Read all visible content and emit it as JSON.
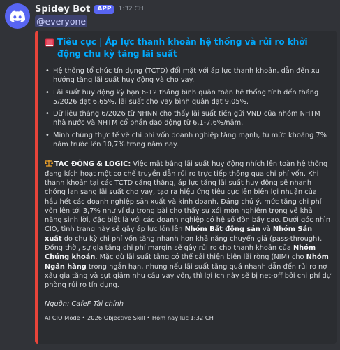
{
  "bot": {
    "name": "Spidey Bot",
    "badge": "APP",
    "time": "1:32 CH",
    "mention": "@everyone"
  },
  "embed": {
    "accent_color": "#e8443a",
    "title_icon": "red-book-icon",
    "title": "Tiêu cực | Áp lực thanh khoản hệ thống và rủi ro khởi động chu kỳ tăng lãi suất",
    "bullets": [
      "Hệ thống tổ chức tín dụng (TCTD) đối mặt với áp lực thanh khoản, dẫn đến xu hướng tăng lãi suất huy động và cho vay.",
      "Lãi suất huy động kỳ hạn 6-12 tháng bình quân toàn hệ thống tính đến tháng 5/2026 đạt 6,65%, lãi suất cho vay bình quân đạt 9,05%.",
      "Dữ liệu tháng 6/2026 từ NHNN cho thấy lãi suất tiền gửi VND của nhóm NHTM nhà nước và NHTM cổ phần dao động từ 6,1-7,6%/năm.",
      "Minh chứng thực tế về chi phí vốn doanh nghiệp tăng mạnh, từ mức khoảng 7% năm trước lên 10,7% trong năm nay."
    ],
    "analysis": {
      "icon": "scales-icon",
      "label": "TÁC ĐỘNG & LOGIC:",
      "t1": " Việc mặt bằng lãi suất huy động nhích lên toàn hệ thống đang kích hoạt một cơ chế truyền dẫn rủi ro trực tiếp thông qua chi phí vốn. Khi thanh khoản tại các TCTD căng thẳng, áp lực tăng lãi suất huy động sẽ nhanh chóng lan sang lãi suất cho vay, tạo ra hiệu ứng tiêu cực lên biên lợi nhuận của hầu hết các doanh nghiệp sản xuất và kinh doanh. Đáng chú ý, mức tăng chi phí vốn lên tới 3,7% như ví dụ trong bài cho thấy sự xói mòn nghiêm trọng về khả năng sinh lời, đặc biệt là với các doanh nghiệp có hệ số đòn bẩy cao. Dưới góc nhìn CIO, tình trạng này sẽ gây áp lực lớn lên ",
      "b1": "Nhóm Bất động sản",
      "t2": " và ",
      "b2": "Nhóm Sản xuất",
      "t3": " do chu kỳ chi phí vốn tăng nhanh hơn khả năng chuyển giá (pass-through). Đồng thời, sự gia tăng chi phí margin sẽ gây rủi ro cho thanh khoản của ",
      "b3": "Nhóm Chứng khoán",
      "t4": ". Mặc dù lãi suất tăng có thể cải thiện biên lãi ròng (NIM) cho ",
      "b4": "Nhóm Ngân hàng",
      "t5": " trong ngắn hạn, nhưng nếu lãi suất tăng quá nhanh dẫn đến rủi ro nợ xấu gia tăng và sụt giảm nhu cầu vay vốn, thì lợi ích này sẽ bị net-off bởi chi phí dự phòng rủi ro tín dụng."
    },
    "source": "Nguồn: CafeF Tài chính",
    "footer": "AI CIO Mode • 2026 Objective Skill • Hôm nay lúc 1:32 CH"
  }
}
